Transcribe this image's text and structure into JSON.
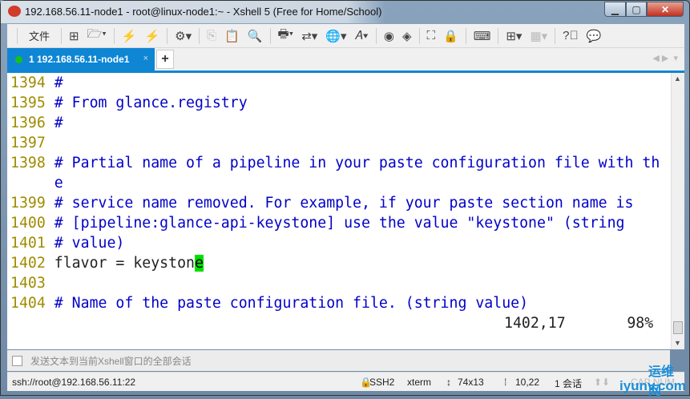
{
  "window": {
    "title": "192.168.56.11-node1 - root@linux-node1:~ - Xshell 5 (Free for Home/School)",
    "minimize": "▁",
    "maximize": "▢",
    "close": "✕"
  },
  "toolbar": {
    "file_menu": "文件"
  },
  "tabs": [
    {
      "label": "1 192.168.56.11-node1",
      "close": "×"
    }
  ],
  "tab_add": "+",
  "terminal": {
    "lines": [
      {
        "num": "1394",
        "text": "#",
        "type": "comment"
      },
      {
        "num": "1395",
        "text": "# From glance.registry",
        "type": "comment"
      },
      {
        "num": "1396",
        "text": "#",
        "type": "comment"
      },
      {
        "num": "1397",
        "text": "",
        "type": "comment"
      },
      {
        "num": "1398",
        "text": "# Partial name of a pipeline in your paste configuration file with th",
        "type": "comment"
      },
      {
        "num": "",
        "text": "e",
        "type": "comment"
      },
      {
        "num": "1399",
        "text": "# service name removed. For example, if your paste section name is",
        "type": "comment"
      },
      {
        "num": "1400",
        "text": "# [pipeline:glance-api-keystone] use the value \"keystone\" (string",
        "type": "comment"
      },
      {
        "num": "1401",
        "text": "# value)",
        "type": "comment"
      },
      {
        "num": "1402",
        "text": "flavor = keyston",
        "type": "text",
        "cursor": "e"
      },
      {
        "num": "1403",
        "text": "",
        "type": "comment"
      },
      {
        "num": "1404",
        "text": "# Name of the paste configuration file. (string value)",
        "type": "comment"
      }
    ],
    "position": "1402,17",
    "percent": "98%"
  },
  "send_bar": {
    "placeholder": "发送文本到当前Xshell窗口的全部会话"
  },
  "statusbar": {
    "connection": "ssh://root@192.168.56.11:22",
    "protocol": "SSH2",
    "term": "xterm",
    "size": "74x13",
    "cursor": "10,22",
    "sessions": "1 会话",
    "caps": "CAP NUM"
  },
  "watermark": {
    "text1": "运维网",
    "text2": "iyunv.com"
  }
}
